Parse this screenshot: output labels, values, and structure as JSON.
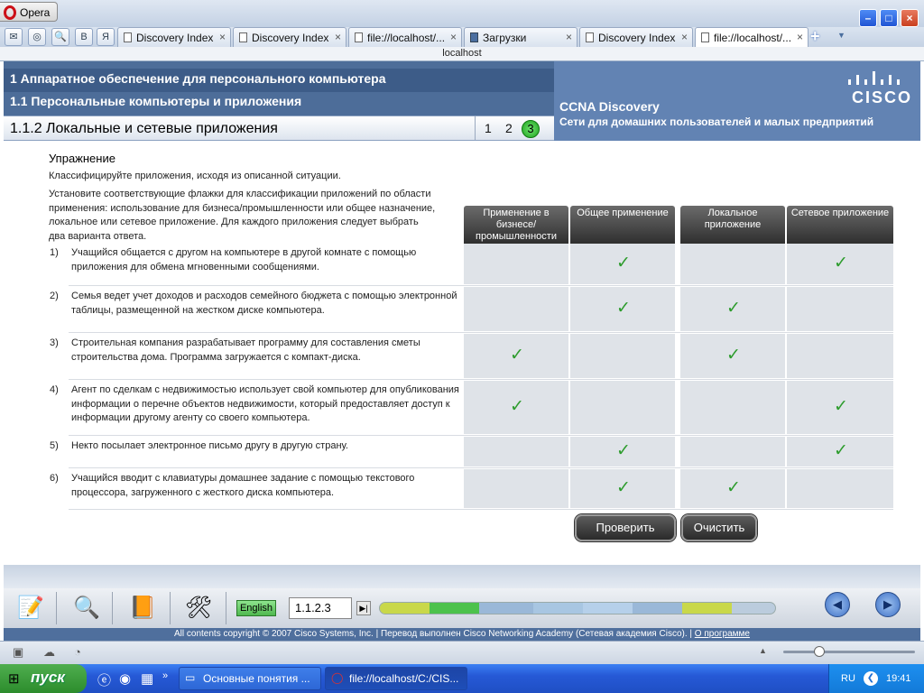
{
  "browser": {
    "app_name": "Opera",
    "address": "localhost",
    "tabs": [
      {
        "label": "Discovery Index",
        "active": false
      },
      {
        "label": "Discovery Index",
        "active": false
      },
      {
        "label": "file://localhost/...",
        "active": false
      },
      {
        "label": "Загрузки",
        "active": false
      },
      {
        "label": "Discovery Index",
        "active": false
      },
      {
        "label": "file://localhost/...",
        "active": true
      }
    ],
    "quick_icons": [
      "mail-icon",
      "opera-unite-icon",
      "search-icon",
      "vk-icon",
      "yandex-icon"
    ],
    "quick_icon_glyphs": [
      "✉",
      "◎",
      "🔍",
      "B",
      "Я"
    ],
    "new_tab": "+",
    "tab_close": "×"
  },
  "course": {
    "chapter": "1 Аппаратное обеспечение для персонального компьютера",
    "section": "1.1 Персональные компьютеры и приложения",
    "subsection": "1.1.2 Локальные и сетевые приложения",
    "pages": [
      "1",
      "2",
      "3"
    ],
    "current_page": "3",
    "brand": "CISCO",
    "program": "CCNA Discovery",
    "program_subtitle": "Сети для домашних пользователей и малых предприятий"
  },
  "exercise": {
    "title": "Упражнение",
    "instruction1": "Классифицируйте приложения, исходя из описанной ситуации.",
    "instruction2": "Установите соответствующие флажки для классификации приложений по области применения: использование для бизнеса/промышленности или общее назначение, локальное или сетевое приложение. Для каждого приложения следует выбрать два варианта ответа.",
    "columns": [
      "Применение в бизнесе/промышленности",
      "Общее применение",
      "Локальное приложение",
      "Сетевое приложение"
    ],
    "check_glyph": "✓",
    "rows": [
      {
        "num": "1)",
        "text": "Учащийся общается с другом на компьютере в другой комнате с помощью приложения для обмена мгновенными сообщениями.",
        "checks": [
          false,
          true,
          false,
          true
        ]
      },
      {
        "num": "2)",
        "text": "Семья ведет учет доходов и расходов семейного бюджета с помощью электронной таблицы, размещенной на жестком диске компьютера.",
        "checks": [
          false,
          true,
          true,
          false
        ]
      },
      {
        "num": "3)",
        "text": "Строительная компания разрабатывает программу для составления сметы строительства дома.  Программа загружается с компакт-диска.",
        "checks": [
          true,
          false,
          true,
          false
        ]
      },
      {
        "num": "4)",
        "text": "Агент по сделкам с недвижимостью использует свой компьютер для опубликования информации о перечне объектов недвижимости, который предоставляет доступ к информации другому агенту со своего компьютера.",
        "checks": [
          true,
          false,
          false,
          true
        ]
      },
      {
        "num": "5)",
        "text": "Некто посылает электронное письмо другу в другую страну.",
        "checks": [
          false,
          true,
          false,
          true
        ]
      },
      {
        "num": "6)",
        "text": "Учащийся вводит с клавиатуры домашнее задание с помощью текстового процессора, загруженного с жесткого диска компьютера.",
        "checks": [
          false,
          true,
          true,
          false
        ]
      }
    ],
    "check_button": "Проверить",
    "clear_button": "Очистить"
  },
  "toolbar": {
    "language": "English",
    "page_field": "1.1.2.3",
    "progress_colors": [
      "#c9d84a",
      "#4cc24c",
      "#9ab8d8",
      "#a8c6e2",
      "#b6d0ea",
      "#9ab8d8",
      "#c9d84a",
      "#4a72b0"
    ],
    "copyright": "All contents copyright © 2007 Cisco Systems, Inc. | Перевод выполнен Cisco Networking Academy (Сетевая академия Cisco). |",
    "about_link": "О программе"
  },
  "taskbar": {
    "start": "пуск",
    "tasks": [
      {
        "label": "Основные понятия ...",
        "active": false
      },
      {
        "label": "file://localhost/C:/CIS...",
        "active": true
      }
    ],
    "language": "RU",
    "time": "19:41"
  },
  "colors": {
    "header_blue": "#4d6d99",
    "check_green": "#2d9c2d",
    "current_page_green": "#1ea21e"
  }
}
